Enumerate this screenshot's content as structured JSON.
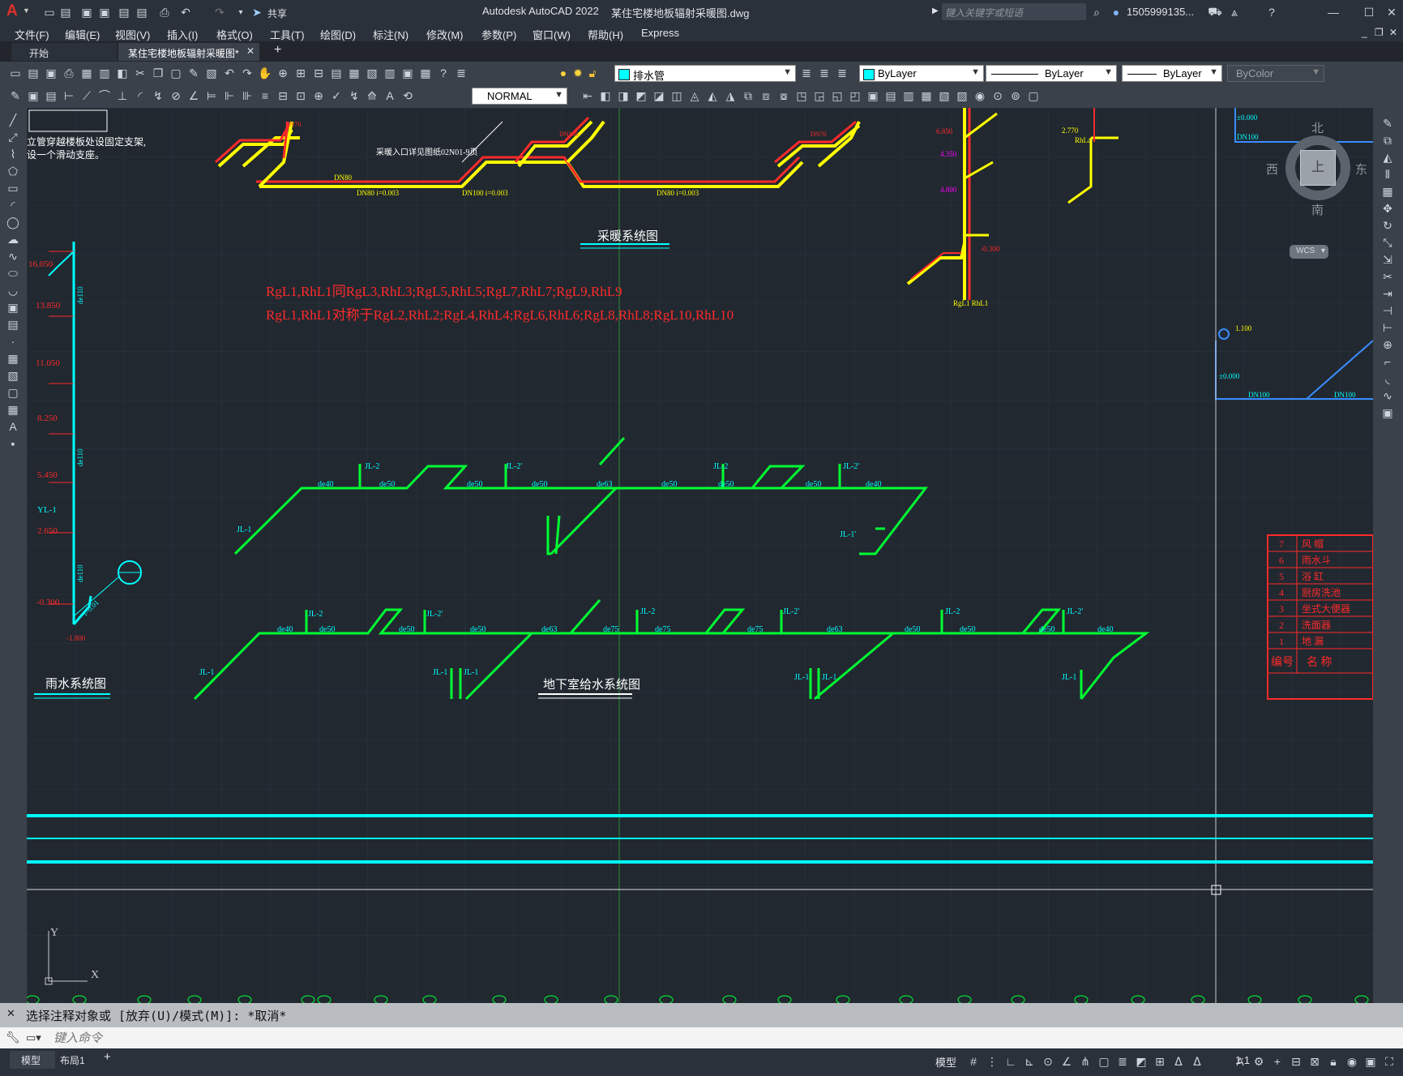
{
  "titlebar": {
    "app_title": "Autodesk AutoCAD 2022",
    "file_title": "某住宅楼地板辐射采暖图.dwg",
    "search_placeholder": "键入关键字或短语",
    "user": "1505999135...",
    "share_label": "共享"
  },
  "menu": [
    "文件(F)",
    "编辑(E)",
    "视图(V)",
    "插入(I)",
    "格式(O)",
    "工具(T)",
    "绘图(D)",
    "标注(N)",
    "修改(M)",
    "参数(P)",
    "窗口(W)",
    "帮助(H)",
    "Express"
  ],
  "tabs": {
    "start": "开始",
    "active": "某住宅楼地板辐射采暖图*",
    "add": "+"
  },
  "toolbar": {
    "layer": "排水管",
    "color": "ByLayer",
    "linetype": "ByLayer",
    "lineweight": "ByLayer",
    "plotstyle": "ByColor",
    "textstyle": "NORMAL"
  },
  "viewcube": {
    "north": "北",
    "south": "南",
    "east": "东",
    "west": "西",
    "top": "上",
    "wcs": "WCS"
  },
  "drawing": {
    "heating_title": "采暖系统图",
    "rain_title": "雨水系统图",
    "water_title": "地下室给水系统图",
    "note1": "立管穿越楼板处设固定支架,",
    "note2": "设一个滑动支座。",
    "red_line1": "RgL1,RhL1同RgL3,RhL3;RgL5,RhL5;RgL7,RhL7;RgL9,RhL9",
    "red_line2": "RgL1,RhL1对称于RgL2,RhL2;RgL4,RhL4;RgL6,RhL6;RgL8,RhL8;RgL10,RhL10",
    "rain_levels": [
      "16.050",
      "13.850",
      "11.050",
      "8.250",
      "5.450",
      "2.650",
      "-0.300"
    ],
    "rain_label": "YL-1",
    "legend": [
      {
        "no": "7",
        "name": "风 帽"
      },
      {
        "no": "6",
        "name": "雨水斗"
      },
      {
        "no": "5",
        "name": "浴 缸"
      },
      {
        "no": "4",
        "name": "厨房洗池"
      },
      {
        "no": "3",
        "name": "坐式大便器"
      },
      {
        "no": "2",
        "name": "洗面器"
      },
      {
        "no": "1",
        "name": "地 漏"
      }
    ],
    "legend_header": {
      "no": "编号",
      "name": "名 称"
    }
  },
  "command": {
    "history": "选择注释对象或 [放弃(U)/模式(M)]: *取消*",
    "placeholder": "键入命令"
  },
  "status": {
    "model_tab": "模型",
    "layout_tab": "布局1",
    "add": "+",
    "model_label": "模型",
    "scale": "1:1"
  }
}
